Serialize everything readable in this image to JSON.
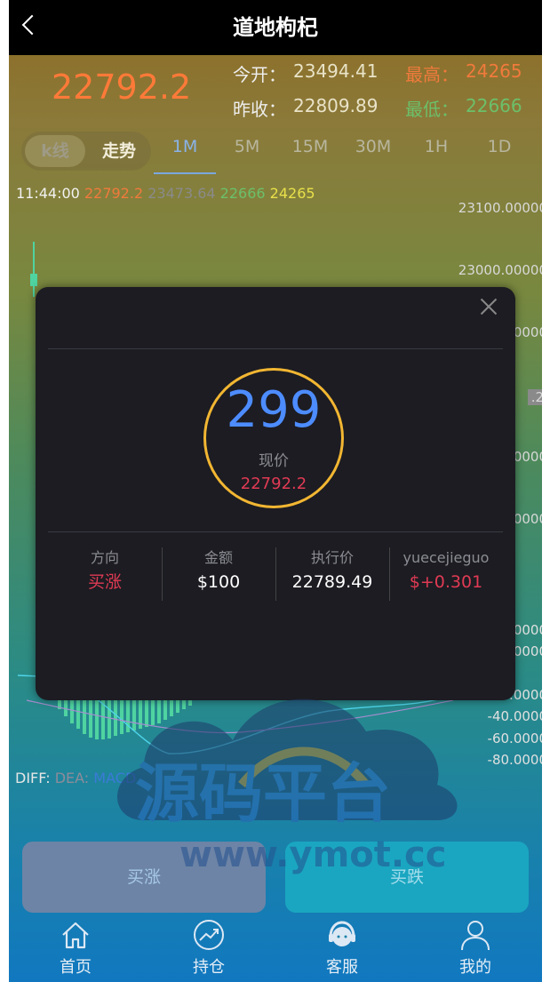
{
  "header": {
    "title": "道地枸杞"
  },
  "quote": {
    "price": "22792.2",
    "open_label": "今开：",
    "open_value": "23494.41",
    "high_label": "最高：",
    "high_value": "24265",
    "prev_close_label": "昨收：",
    "prev_close_value": "22809.89",
    "low_label": "最低：",
    "low_value": "22666"
  },
  "chart_tabs": {
    "kline": "k线",
    "trend": "走势",
    "intervals": [
      "1M",
      "5M",
      "15M",
      "30M",
      "1H",
      "1D"
    ],
    "active_interval": "1M"
  },
  "chart_info": {
    "time": "11:44:00",
    "v1": "22792.2",
    "v2": "23473.64",
    "v3": "22666",
    "v4": "24265"
  },
  "price_axis": [
    "23100.00000",
    "23000.00000",
    ".0000",
    ".2",
    ".0000",
    ".0000"
  ],
  "macd_axis": [
    ".0000",
    ".0000",
    ".0000",
    "-40.0000",
    "-60.0000",
    "-80.0000"
  ],
  "macd_legend": {
    "diff": "DIFF:",
    "dea": "DEA:",
    "macd": "MACD"
  },
  "buttons": {
    "buy_up": "买涨",
    "buy_down": "买跌"
  },
  "nav": [
    {
      "label": "首页",
      "icon": "home-icon"
    },
    {
      "label": "持仓",
      "icon": "chart-trend-icon"
    },
    {
      "label": "客服",
      "icon": "headset-icon"
    },
    {
      "label": "我的",
      "icon": "user-icon"
    }
  ],
  "modal": {
    "countdown": "299",
    "current_label": "现价",
    "current_price": "22792.2",
    "columns": [
      {
        "header": "方向",
        "value": "买涨",
        "color": "#e03a54"
      },
      {
        "header": "金额",
        "value": "$100",
        "color": "#ffffff"
      },
      {
        "header": "执行价",
        "value": "22789.49",
        "color": "#ffffff"
      },
      {
        "header": "yuecejieguo",
        "value": "$+0.301",
        "color": "#e03a54"
      }
    ]
  },
  "watermark": {
    "main": "源码平台",
    "url": "www.ymot.cc"
  },
  "colors": {
    "up": "#e03a54",
    "down": "#4fd3a0",
    "accent": "#4d8cff",
    "ring": "#f2b632"
  }
}
